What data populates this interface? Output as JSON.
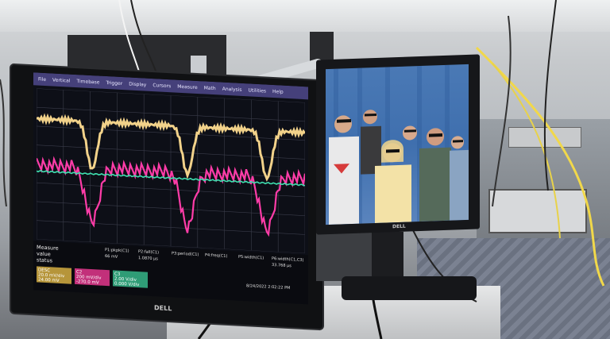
{
  "scene": {
    "description_tags": [
      "oscilloscope-monitor",
      "photo-monitor",
      "lab-equipment"
    ]
  },
  "scope": {
    "menu": [
      "File",
      "Vertical",
      "Timebase",
      "Trigger",
      "Display",
      "Cursors",
      "Measure",
      "Math",
      "Analysis",
      "Utilities",
      "Help"
    ],
    "measure_labels": {
      "measure": "Measure",
      "value": "value",
      "status": "status"
    },
    "params": [
      {
        "label": "P1:pkpk(C1)",
        "value": "66 mV"
      },
      {
        "label": "P2:fall(C1)",
        "value": "1.0870 µs"
      },
      {
        "label": "P3:period(C1)",
        "value": ""
      },
      {
        "label": "P4:freq(C1)",
        "value": ""
      },
      {
        "label": "P5:width(C1)",
        "value": ""
      },
      {
        "label": "P6:width(C1,C3)",
        "value": "33.768 µs"
      }
    ],
    "channel_chips": [
      {
        "name": "DESC",
        "line1": "20.0 mV/div",
        "line2": "24.00 mV",
        "color": "#b6953a"
      },
      {
        "name": "C2",
        "line1": "200 mV/div",
        "line2": "-270.0 mV",
        "color": "#c2307a"
      },
      {
        "name": "C3",
        "line1": "2.00 V/div",
        "line2": "0.000 V/div",
        "color": "#2f9c76"
      }
    ],
    "timestamp": "8/24/2022 2:02:22 PM",
    "brand": "DELL",
    "trace_colors": {
      "ch1": "#f2d28a",
      "ch2": "#ff3ca8",
      "ch3": "#3fe0b0"
    }
  },
  "photo_monitor": {
    "brand": "DELL"
  }
}
